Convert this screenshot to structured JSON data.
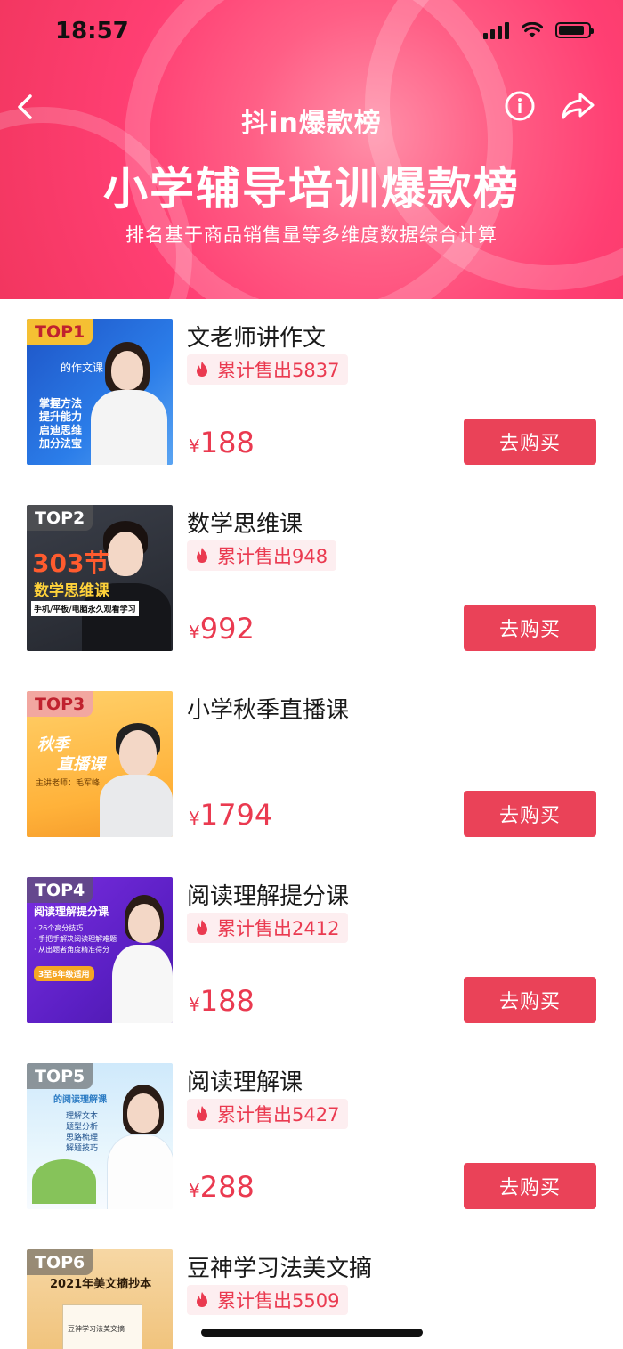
{
  "status": {
    "time": "18:57"
  },
  "header": {
    "brand": "抖in爆款榜",
    "title": "小学辅导培训爆款榜",
    "subtitle": "排名基于商品销售量等多维度数据综合计算"
  },
  "colors": {
    "accent": "#ea4258",
    "header": "#f2365f"
  },
  "items": [
    {
      "rank": "TOP1",
      "name": "文老师讲作文",
      "sold": "累计售出5837",
      "currency": "¥",
      "price": "188",
      "buy": "去购买",
      "cover": {
        "line1": "的作文课",
        "line2": "掌握方法",
        "line3": "提升能力",
        "line4": "启迪思维",
        "line5": "加分法宝"
      }
    },
    {
      "rank": "TOP2",
      "name": "数学思维课",
      "sold": "累计售出948",
      "currency": "¥",
      "price": "992",
      "buy": "去购买",
      "cover": {
        "line1": "303节",
        "line2": "数学思维课",
        "line3": "手机/平板/电脑永久观看学习"
      }
    },
    {
      "rank": "TOP3",
      "name": "小学秋季直播课",
      "sold": "",
      "currency": "¥",
      "price": "1794",
      "buy": "去购买",
      "cover": {
        "line1": "秋季",
        "line2": "直播课",
        "line3": "主讲老师：毛军峰"
      }
    },
    {
      "rank": "TOP4",
      "name": "阅读理解提分课",
      "sold": "累计售出2412",
      "currency": "¥",
      "price": "188",
      "buy": "去购买",
      "cover": {
        "line1": "阅读理解提分课",
        "line2": "· 26个高分技巧",
        "line3": "· 手把手解决阅读理解难题",
        "line4": "· 从出题者角度精准得分",
        "line5": "3至6年级适用"
      }
    },
    {
      "rank": "TOP5",
      "name": "阅读理解课",
      "sold": "累计售出5427",
      "currency": "¥",
      "price": "288",
      "buy": "去购买",
      "cover": {
        "line1": "的阅读理解课",
        "line2": "理解文本",
        "line3": "题型分析",
        "line4": "思路梳理",
        "line5": "解题技巧"
      }
    },
    {
      "rank": "TOP6",
      "name": "豆神学习法美文摘",
      "sold": "累计售出5509",
      "currency": "¥",
      "price": "",
      "buy": "",
      "cover": {
        "line1": "2021年美文摘抄本",
        "line2": "豆神学习法美文摘"
      }
    }
  ]
}
